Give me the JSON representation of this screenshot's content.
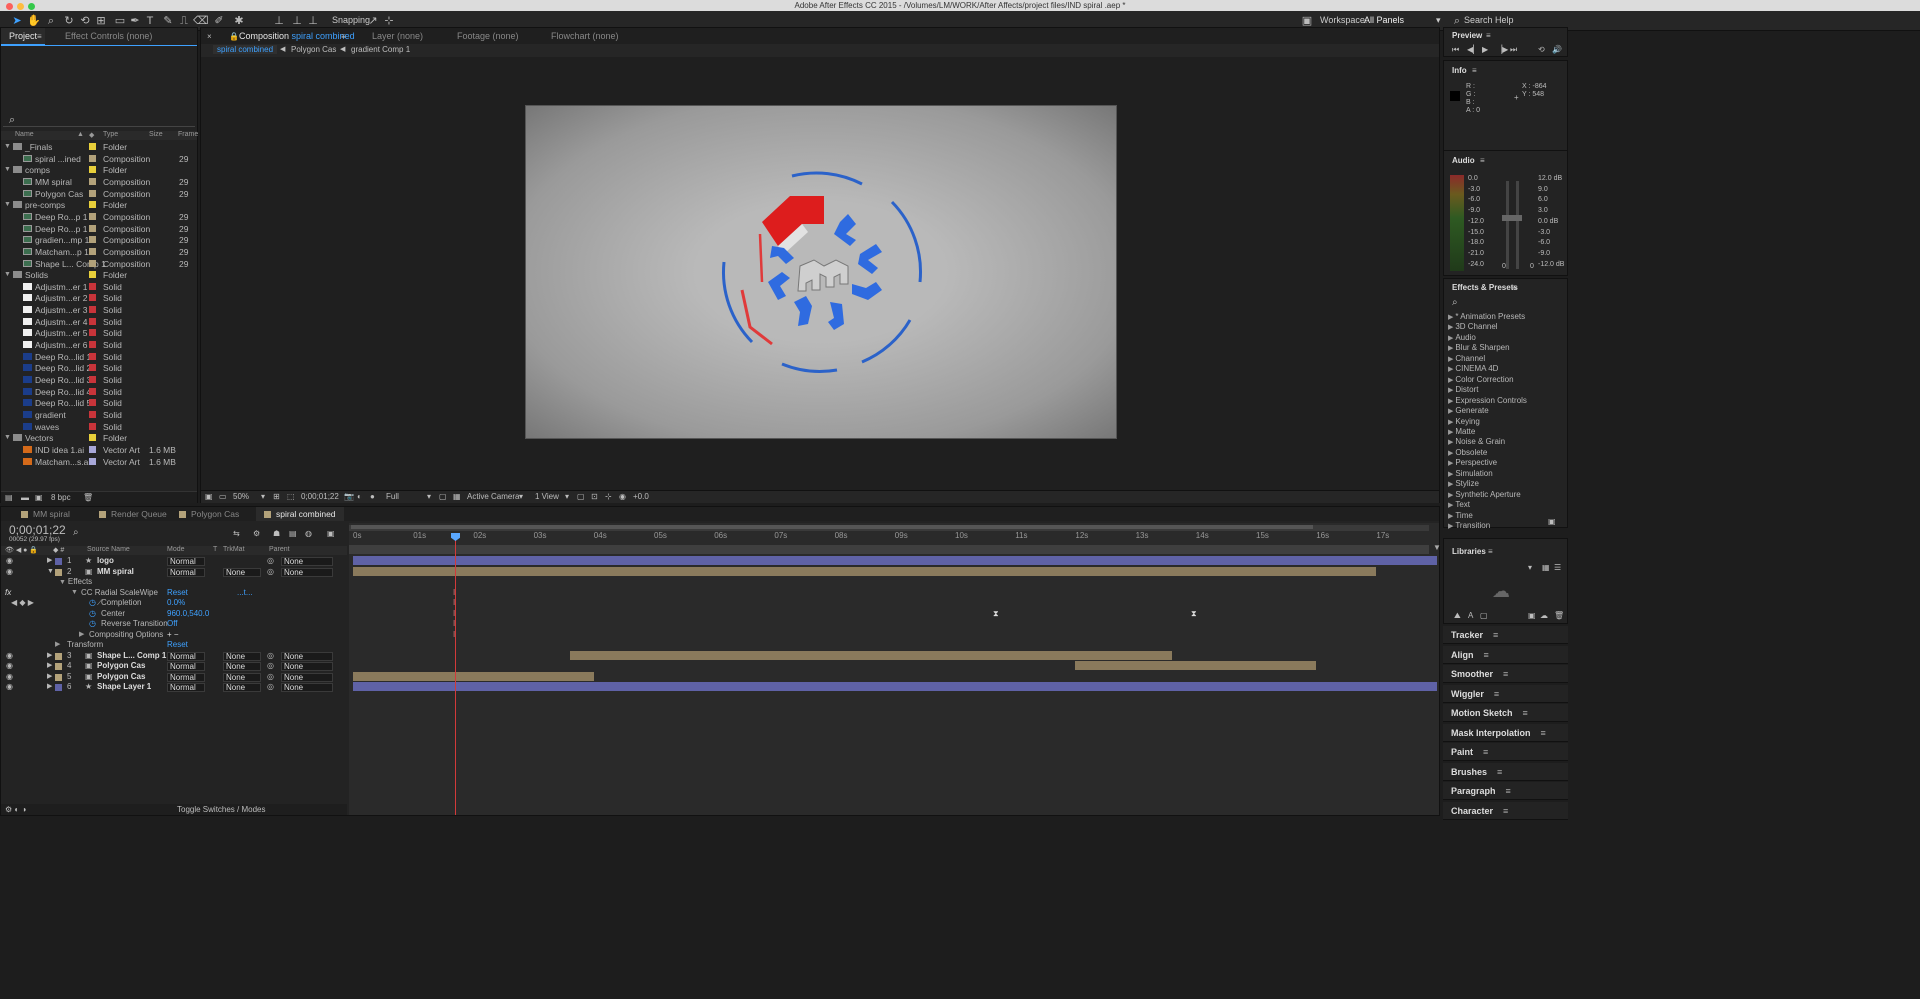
{
  "app": {
    "title": "Adobe After Effects CC 2015 - /Volumes/LM/WORK/After Affects/project files/IND spiral .aep *",
    "snapping_label": "Snapping",
    "workspace_label": "Workspace:",
    "workspace_value": "All Panels",
    "search_help": "Search Help"
  },
  "colors": {
    "accent": "#3ea1ff",
    "comp": "#b3a27a",
    "folder": "#e8cf3a",
    "solid_red": "#c8343a",
    "layer_purple": "#5f62a6",
    "layer_tan": "#8a7a5c"
  },
  "project": {
    "tabs": [
      "Project",
      "Effect Controls (none)"
    ],
    "columns": {
      "name": "Name",
      "type": "Type",
      "size": "Size",
      "frame": "Frame"
    },
    "bpc": "8 bpc",
    "items": [
      {
        "name": "_Finals",
        "type": "Folder",
        "size": "",
        "frame": "",
        "level": 0,
        "color": "#e8cf3a",
        "kind": "folder"
      },
      {
        "name": "spiral ...ined",
        "type": "Composition",
        "size": "",
        "frame": "29",
        "level": 1,
        "color": "#b3a27a",
        "kind": "comp"
      },
      {
        "name": "comps",
        "type": "Folder",
        "size": "",
        "frame": "",
        "level": 0,
        "color": "#e8cf3a",
        "kind": "folder"
      },
      {
        "name": "MM spiral",
        "type": "Composition",
        "size": "",
        "frame": "29",
        "level": 1,
        "color": "#b3a27a",
        "kind": "comp"
      },
      {
        "name": "Polygon Cas",
        "type": "Composition",
        "size": "",
        "frame": "29",
        "level": 1,
        "color": "#b3a27a",
        "kind": "comp"
      },
      {
        "name": "pre-comps",
        "type": "Folder",
        "size": "",
        "frame": "",
        "level": 0,
        "color": "#e8cf3a",
        "kind": "folder"
      },
      {
        "name": "Deep Ro...p 1",
        "type": "Composition",
        "size": "",
        "frame": "29",
        "level": 1,
        "color": "#b3a27a",
        "kind": "comp"
      },
      {
        "name": "Deep Ro...p 1",
        "type": "Composition",
        "size": "",
        "frame": "29",
        "level": 1,
        "color": "#b3a27a",
        "kind": "comp"
      },
      {
        "name": "gradien...mp 1",
        "type": "Composition",
        "size": "",
        "frame": "29",
        "level": 1,
        "color": "#b3a27a",
        "kind": "comp"
      },
      {
        "name": "Matcham...p 1",
        "type": "Composition",
        "size": "",
        "frame": "29",
        "level": 1,
        "color": "#b3a27a",
        "kind": "comp"
      },
      {
        "name": "Shape L... Comp 1",
        "type": "Composition",
        "size": "",
        "frame": "29",
        "level": 1,
        "color": "#b3a27a",
        "kind": "comp"
      },
      {
        "name": "Solids",
        "type": "Folder",
        "size": "",
        "frame": "",
        "level": 0,
        "color": "#e8cf3a",
        "kind": "folder"
      },
      {
        "name": "Adjustm...er 1",
        "type": "Solid",
        "size": "",
        "frame": "",
        "level": 1,
        "color": "#c8343a",
        "kind": "solid-white"
      },
      {
        "name": "Adjustm...er 2",
        "type": "Solid",
        "size": "",
        "frame": "",
        "level": 1,
        "color": "#c8343a",
        "kind": "solid-white"
      },
      {
        "name": "Adjustm...er 3",
        "type": "Solid",
        "size": "",
        "frame": "",
        "level": 1,
        "color": "#c8343a",
        "kind": "solid-white"
      },
      {
        "name": "Adjustm...er 4",
        "type": "Solid",
        "size": "",
        "frame": "",
        "level": 1,
        "color": "#c8343a",
        "kind": "solid-white"
      },
      {
        "name": "Adjustm...er 5",
        "type": "Solid",
        "size": "",
        "frame": "",
        "level": 1,
        "color": "#c8343a",
        "kind": "solid-white"
      },
      {
        "name": "Adjustm...er 6",
        "type": "Solid",
        "size": "",
        "frame": "",
        "level": 1,
        "color": "#c8343a",
        "kind": "solid-white"
      },
      {
        "name": "Deep Ro...lid 1",
        "type": "Solid",
        "size": "",
        "frame": "",
        "level": 1,
        "color": "#c8343a",
        "kind": "solid-blue"
      },
      {
        "name": "Deep Ro...lid 2",
        "type": "Solid",
        "size": "",
        "frame": "",
        "level": 1,
        "color": "#c8343a",
        "kind": "solid-blue"
      },
      {
        "name": "Deep Ro...lid 3",
        "type": "Solid",
        "size": "",
        "frame": "",
        "level": 1,
        "color": "#c8343a",
        "kind": "solid-blue"
      },
      {
        "name": "Deep Ro...lid 4",
        "type": "Solid",
        "size": "",
        "frame": "",
        "level": 1,
        "color": "#c8343a",
        "kind": "solid-blue"
      },
      {
        "name": "Deep Ro...lid 5",
        "type": "Solid",
        "size": "",
        "frame": "",
        "level": 1,
        "color": "#c8343a",
        "kind": "solid-blue"
      },
      {
        "name": "gradient",
        "type": "Solid",
        "size": "",
        "frame": "",
        "level": 1,
        "color": "#c8343a",
        "kind": "solid-blue"
      },
      {
        "name": "waves",
        "type": "Solid",
        "size": "",
        "frame": "",
        "level": 1,
        "color": "#c8343a",
        "kind": "solid-blue"
      },
      {
        "name": "Vectors",
        "type": "Folder",
        "size": "",
        "frame": "",
        "level": 0,
        "color": "#e8cf3a",
        "kind": "folder"
      },
      {
        "name": "IND idea 1.ai",
        "type": "Vector Art",
        "size": "1.6 MB",
        "frame": "",
        "level": 1,
        "color": "#a7a7d8",
        "kind": "ai"
      },
      {
        "name": "Matcham...s.ai",
        "type": "Vector Art",
        "size": "1.6 MB",
        "frame": "",
        "level": 1,
        "color": "#a7a7d8",
        "kind": "ai"
      }
    ]
  },
  "viewer": {
    "tabs": [
      "Composition",
      "Layer (none)",
      "Footage (none)",
      "Flowchart (none)"
    ],
    "comp_name": "spiral combined",
    "breadcrumbs": [
      "spiral combined",
      "Polygon Cas",
      "gradient Comp 1"
    ],
    "zoom": "50%",
    "timecode": "0;00;01;22",
    "resolution": "Full",
    "camera": "Active Camera",
    "views": "1 View",
    "exposure": "+0.0"
  },
  "timeline": {
    "tabs": [
      "MM spiral",
      "Render Queue",
      "Polygon Cas",
      "spiral combined"
    ],
    "timecode": "0;00;01;22",
    "fps_line": "00052 (29.97 fps)",
    "columns": {
      "source": "Source Name",
      "mode": "Mode",
      "t": "T",
      "trkmat": "TrkMat",
      "parent": "Parent"
    },
    "ruler": [
      "0s",
      "01s",
      "02s",
      "03s",
      "04s",
      "05s",
      "06s",
      "07s",
      "08s",
      "09s",
      "10s",
      "11s",
      "12s",
      "13s",
      "14s",
      "15s",
      "16s",
      "17s"
    ],
    "layers": [
      {
        "num": "1",
        "name": "logo",
        "mode": "Normal",
        "trkmat": "",
        "parent": "None",
        "color": "#5f62a6"
      },
      {
        "num": "2",
        "name": "MM spiral",
        "mode": "Normal",
        "trkmat": "None",
        "parent": "None",
        "color": "#b3a27a"
      },
      {
        "num": "3",
        "name": "Shape L... Comp 1",
        "mode": "Normal",
        "trkmat": "None",
        "parent": "None",
        "color": "#b3a27a"
      },
      {
        "num": "4",
        "name": "Polygon Cas",
        "mode": "Normal",
        "trkmat": "None",
        "parent": "None",
        "color": "#b3a27a"
      },
      {
        "num": "5",
        "name": "Polygon Cas",
        "mode": "Normal",
        "trkmat": "None",
        "parent": "None",
        "color": "#b3a27a"
      },
      {
        "num": "6",
        "name": "Shape Layer 1",
        "mode": "Normal",
        "trkmat": "None",
        "parent": "None",
        "color": "#5f62a6"
      }
    ],
    "effects_label": "Effects",
    "effect_name": "CC Radial ScaleWipe",
    "effect_reset": "Reset",
    "effect_extra": "...t...",
    "props": [
      {
        "name": "Completion",
        "value": "0.0%"
      },
      {
        "name": "Center",
        "value": "960.0,540.0"
      },
      {
        "name": "Reverse Transition",
        "value": "Off"
      }
    ],
    "compositing_options": "Compositing Options",
    "compositing_value": "+ −",
    "transform_label": "Transform",
    "transform_reset": "Reset",
    "toggle_label": "Toggle Switches / Modes"
  },
  "right": {
    "preview": "Preview",
    "info": "Info",
    "info_rgb": [
      "R :",
      "G :",
      "B :",
      "A : 0"
    ],
    "info_xy": [
      "X : -864",
      "Y : 548"
    ],
    "audio": "Audio",
    "audio_left": [
      "0.0",
      "-3.0",
      "-6.0",
      "-9.0",
      "-12.0",
      "-15.0",
      "-18.0",
      "-21.0",
      "-24.0"
    ],
    "audio_right": [
      "12.0 dB",
      "9.0",
      "6.0",
      "3.0",
      "0.0 dB",
      "-3.0",
      "-6.0",
      "-9.0",
      "-12.0 dB"
    ],
    "audio_zero": [
      "0",
      "0"
    ],
    "effects_presets": "Effects & Presets",
    "presets": [
      "* Animation Presets",
      "3D Channel",
      "Audio",
      "Blur & Sharpen",
      "Channel",
      "CINEMA 4D",
      "Color Correction",
      "Distort",
      "Expression Controls",
      "Generate",
      "Keying",
      "Matte",
      "Noise & Grain",
      "Obsolete",
      "Perspective",
      "Simulation",
      "Stylize",
      "Synthetic Aperture",
      "Text",
      "Time",
      "Transition"
    ],
    "libraries": "Libraries",
    "panels": [
      "Tracker",
      "Align",
      "Smoother",
      "Wiggler",
      "Motion Sketch",
      "Mask Interpolation",
      "Paint",
      "Brushes",
      "Paragraph",
      "Character"
    ]
  }
}
